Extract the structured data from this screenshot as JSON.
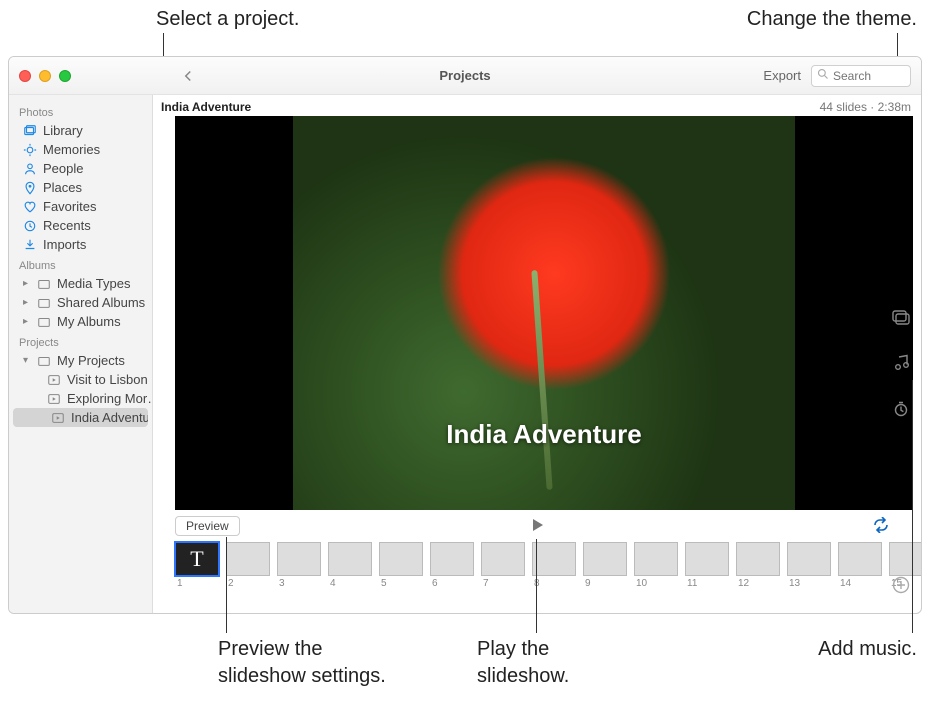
{
  "annotations": {
    "select_project": "Select a project.",
    "change_theme": "Change the theme.",
    "preview_settings": "Preview the\nslideshow settings.",
    "play_slideshow": "Play the\nslideshow.",
    "add_music": "Add music."
  },
  "titlebar": {
    "title": "Projects",
    "export": "Export",
    "search_placeholder": "Search"
  },
  "sidebar": {
    "section_photos": "Photos",
    "photos_items": [
      {
        "label": "Library"
      },
      {
        "label": "Memories"
      },
      {
        "label": "People"
      },
      {
        "label": "Places"
      },
      {
        "label": "Favorites"
      },
      {
        "label": "Recents"
      },
      {
        "label": "Imports"
      }
    ],
    "section_albums": "Albums",
    "albums_items": [
      {
        "label": "Media Types"
      },
      {
        "label": "Shared Albums"
      },
      {
        "label": "My Albums"
      }
    ],
    "section_projects": "Projects",
    "my_projects": "My Projects",
    "project_items": [
      {
        "label": "Visit to Lisbon"
      },
      {
        "label": "Exploring Mor…"
      },
      {
        "label": "India Adventure"
      }
    ]
  },
  "project": {
    "name": "India Adventure",
    "meta": "44 slides · 2:38m",
    "caption": "India Adventure"
  },
  "transport": {
    "preview": "Preview"
  },
  "thumbs": {
    "title_glyph": "T",
    "numbers": [
      "1",
      "2",
      "3",
      "4",
      "5",
      "6",
      "7",
      "8",
      "9",
      "10",
      "11",
      "12",
      "13",
      "14",
      "15"
    ]
  }
}
